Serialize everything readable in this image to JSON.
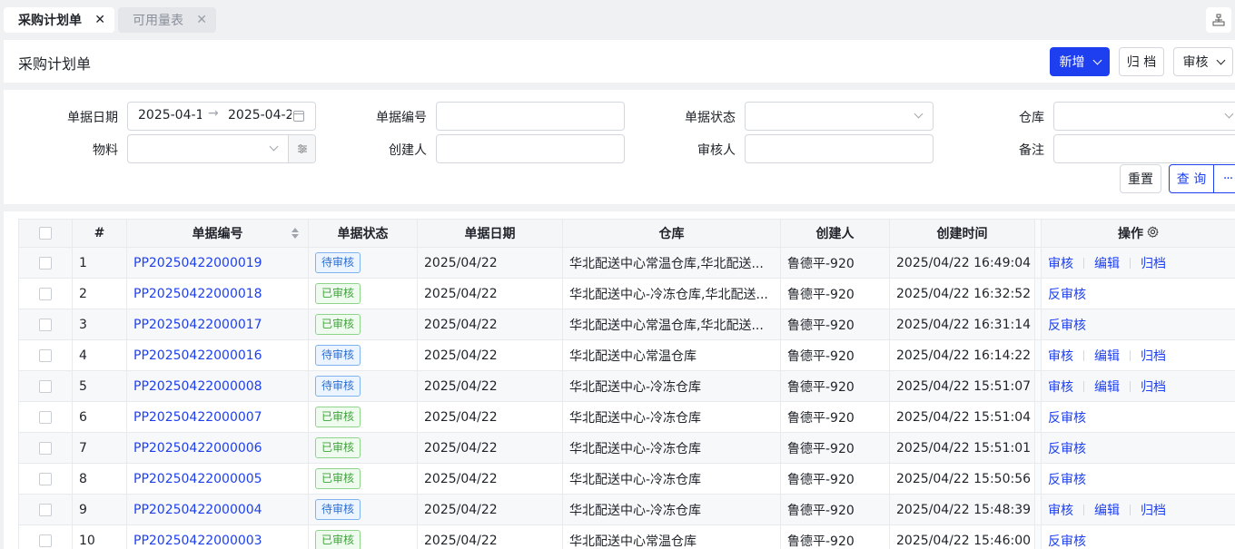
{
  "tabs": [
    {
      "label": "采购计划单",
      "close": "✕"
    },
    {
      "label": "可用量表",
      "close": "✕"
    }
  ],
  "header": {
    "title": "采购计划单",
    "new_label": "新增",
    "archive_label": "归 档",
    "audit_label": "审核"
  },
  "filters": {
    "date_label": "单据日期",
    "date_start": "2025-04-1",
    "date_end": "2025-04-2",
    "doc_no_label": "单据编号",
    "status_label": "单据状态",
    "warehouse_label": "仓库",
    "material_label": "物料",
    "creator_label": "创建人",
    "reviewer_label": "审核人",
    "remark_label": "备注",
    "reset_label": "重置",
    "query_label": "查 询",
    "more_label": "···"
  },
  "table": {
    "headers": [
      "#",
      "单据编号",
      "单据状态",
      "单据日期",
      "仓库",
      "创建人",
      "创建时间",
      "操作"
    ],
    "rows": [
      {
        "idx": "1",
        "no": "PP20250422000019",
        "status": "待审核",
        "state": "pending",
        "date": "2025/04/22",
        "warehouse": "华北配送中心常温仓库,华北配送...",
        "creator": "鲁德平-920",
        "created": "2025/04/22 16:49:04",
        "ops": [
          "审核",
          "编辑",
          "归档"
        ]
      },
      {
        "idx": "2",
        "no": "PP20250422000018",
        "status": "已审核",
        "state": "approved",
        "date": "2025/04/22",
        "warehouse": "华北配送中心-冷冻仓库,华北配送...",
        "creator": "鲁德平-920",
        "created": "2025/04/22 16:32:52",
        "ops": [
          "反审核"
        ]
      },
      {
        "idx": "3",
        "no": "PP20250422000017",
        "status": "已审核",
        "state": "approved",
        "date": "2025/04/22",
        "warehouse": "华北配送中心常温仓库,华北配送...",
        "creator": "鲁德平-920",
        "created": "2025/04/22 16:31:14",
        "ops": [
          "反审核"
        ]
      },
      {
        "idx": "4",
        "no": "PP20250422000016",
        "status": "待审核",
        "state": "pending",
        "date": "2025/04/22",
        "warehouse": "华北配送中心常温仓库",
        "creator": "鲁德平-920",
        "created": "2025/04/22 16:14:22",
        "ops": [
          "审核",
          "编辑",
          "归档"
        ]
      },
      {
        "idx": "5",
        "no": "PP20250422000008",
        "status": "待审核",
        "state": "pending",
        "date": "2025/04/22",
        "warehouse": "华北配送中心-冷冻仓库",
        "creator": "鲁德平-920",
        "created": "2025/04/22 15:51:07",
        "ops": [
          "审核",
          "编辑",
          "归档"
        ]
      },
      {
        "idx": "6",
        "no": "PP20250422000007",
        "status": "已审核",
        "state": "approved",
        "date": "2025/04/22",
        "warehouse": "华北配送中心-冷冻仓库",
        "creator": "鲁德平-920",
        "created": "2025/04/22 15:51:04",
        "ops": [
          "反审核"
        ]
      },
      {
        "idx": "7",
        "no": "PP20250422000006",
        "status": "已审核",
        "state": "approved",
        "date": "2025/04/22",
        "warehouse": "华北配送中心-冷冻仓库",
        "creator": "鲁德平-920",
        "created": "2025/04/22 15:51:01",
        "ops": [
          "反审核"
        ]
      },
      {
        "idx": "8",
        "no": "PP20250422000005",
        "status": "已审核",
        "state": "approved",
        "date": "2025/04/22",
        "warehouse": "华北配送中心-冷冻仓库",
        "creator": "鲁德平-920",
        "created": "2025/04/22 15:50:56",
        "ops": [
          "反审核"
        ]
      },
      {
        "idx": "9",
        "no": "PP20250422000004",
        "status": "待审核",
        "state": "pending",
        "date": "2025/04/22",
        "warehouse": "华北配送中心-冷冻仓库",
        "creator": "鲁德平-920",
        "created": "2025/04/22 15:48:39",
        "ops": [
          "审核",
          "编辑",
          "归档"
        ]
      },
      {
        "idx": "10",
        "no": "PP20250422000003",
        "status": "已审核",
        "state": "approved",
        "date": "2025/04/22",
        "warehouse": "华北配送中心常温仓库",
        "creator": "鲁德平-920",
        "created": "2025/04/22 15:46:00",
        "ops": [
          "反审核"
        ]
      }
    ]
  },
  "colors": {
    "primary": "#1d3ff0",
    "pending_tag": "#2b6fd6",
    "approved_tag": "#3fa33b"
  }
}
